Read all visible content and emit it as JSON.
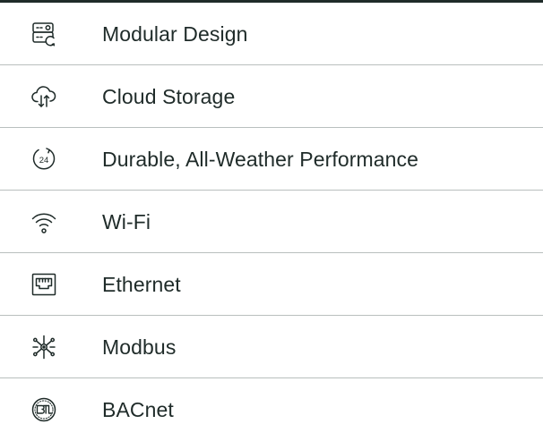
{
  "accent_color": "#1f2b29",
  "divider_color": "#b9bfbe",
  "features": [
    {
      "label": "Modular Design",
      "icon": "modular-design-icon"
    },
    {
      "label": "Cloud Storage",
      "icon": "cloud-sync-icon"
    },
    {
      "label": "Durable, All-Weather Performance",
      "icon": "24-hour-icon"
    },
    {
      "label": "Wi-Fi",
      "icon": "wifi-icon"
    },
    {
      "label": "Ethernet",
      "icon": "ethernet-port-icon"
    },
    {
      "label": "Modbus",
      "icon": "network-hub-icon"
    },
    {
      "label": "BACnet",
      "icon": "btl-badge-icon"
    }
  ]
}
